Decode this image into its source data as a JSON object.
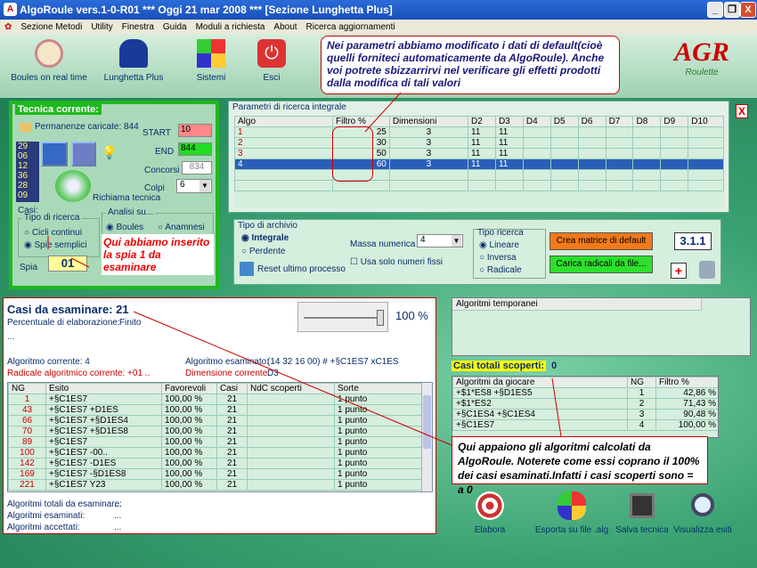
{
  "window": {
    "title": "AlgoRoule vers.1-0-R01  ***  Oggi 21 mar 2008  ***  [Sezione Lunghetta Plus]",
    "min": "_",
    "max": "❐",
    "close": "X"
  },
  "menu": [
    "Sezione Metodi",
    "Utility",
    "Finestra",
    "Guida",
    "Moduli a richiesta",
    "About",
    "Ricerca aggiornamenti"
  ],
  "toolbar": {
    "boules": "Boules on real time",
    "lunghetta": "Lunghetta Plus",
    "sistemi": "Sistemi",
    "esci": "Esci"
  },
  "logo": {
    "text": "AGR",
    "sub": "Roulette"
  },
  "callout_top": "Nei parametri abbiamo modificato i dati di default(cioè quelli forniteci automaticamente da AlgoRoule). Anche voi potrete sbizzarrirvi nel verificare gli effetti prodotti dalla modifica di tali valori",
  "tecnica": {
    "title": "Tecnica corrente:",
    "permanenze": "Permanenze caricate: 844",
    "list": [
      "29",
      "06",
      "12",
      "36",
      "28",
      "09"
    ],
    "start_label": "START",
    "start_value": "10",
    "end_label": "END",
    "end_value": "844",
    "concorsi_label": "Concorsi",
    "concorsi_value": "834",
    "colpi_label": "Colpi",
    "colpi_value": "6",
    "richiama": "Richiama tecnica",
    "casi": "Casi:",
    "tipo_ricerca": "Tipo di ricerca",
    "cicli": "Cicli continui",
    "spie": "Spie semplici",
    "spia_label": "Spia",
    "spia_value": "01",
    "analisi": "Analisi su...",
    "boules": "Boules",
    "anamnesi": "Anamnesi"
  },
  "callout_spia": "Qui abbiamo inserito la spia 1 da esaminare",
  "parametri": {
    "title": "Parametri di ricerca integrale",
    "headers": [
      "Algo",
      "Filtro %",
      "Dimensioni",
      "D2",
      "D3",
      "D4",
      "D5",
      "D6",
      "D7",
      "D8",
      "D9",
      "D10"
    ],
    "rows": [
      [
        "1",
        "25",
        "3",
        "11",
        "11"
      ],
      [
        "2",
        "30",
        "3",
        "11",
        "11"
      ],
      [
        "3",
        "50",
        "3",
        "11",
        "11"
      ],
      [
        "4",
        "60",
        "3",
        "11",
        "11"
      ]
    ]
  },
  "archivio": {
    "title": "Tipo di archivio",
    "integrale": "Integrale",
    "perdente": "Perdente",
    "massa_label": "Massa numerica",
    "massa_value": "4",
    "usa_solo": "Usa solo numeri fissi",
    "reset": "Reset ultimo processo",
    "tipo_title": "Tipo ricerca",
    "lineare": "Lineare",
    "inversa": "Inversa",
    "radicale": "Radicale",
    "crea": "Crea matrice di default",
    "carica": "Carica radicali da file...",
    "version": "3.1.1"
  },
  "casi": {
    "title": "Casi da esaminare: 21",
    "perc_label": "Percentuale di elaborazione:",
    "perc_value": "Finito",
    "dots": "...",
    "progress_text": "100 %",
    "algo_corr": "Algoritmo corrente: 4",
    "algo_esam_label": "Algoritmo esaminato:",
    "algo_esam_value": "(14 32 16 00) # +§C1ES7 xC1ES",
    "radicale": "Radicale algoritmico corrente:   +01 ..",
    "dimensione": "Dimensione corrente:",
    "dimensione_value": "D3",
    "headers": [
      "NG",
      "Esito",
      "Favorevoli",
      "Casi",
      "NdC scoperti",
      "Sorte"
    ],
    "rows": [
      [
        "1",
        "+§C1ES7",
        "100,00 %",
        "21",
        "",
        "1 punto"
      ],
      [
        "43",
        "+§C1ES7 +D1ES",
        "100,00 %",
        "21",
        "",
        "1 punto"
      ],
      [
        "66",
        "+§C1ES7 +§D1ES4",
        "100,00 %",
        "21",
        "",
        "1 punto"
      ],
      [
        "70",
        "+§C1ES7 +§D1ES8",
        "100,00 %",
        "21",
        "",
        "1 punto"
      ],
      [
        "89",
        "+§C1ES7",
        "100,00 %",
        "21",
        "",
        "1 punto"
      ],
      [
        "100",
        "+§C1ES7 -00..",
        "100,00 %",
        "21",
        "",
        "1 punto"
      ],
      [
        "142",
        "+§C1ES7 -D1ES",
        "100,00 %",
        "21",
        "",
        "1 punto"
      ],
      [
        "169",
        "+§C1ES7 -§D1ES8",
        "100,00 %",
        "21",
        "",
        "1 punto"
      ],
      [
        "221",
        "+§C1ES7 Y23",
        "100,00 %",
        "21",
        "",
        "1 punto"
      ]
    ],
    "tot_label": "Algoritmi totali da esaminare:",
    "esam_label": "Algoritmi esaminati:",
    "acc_label": "Algoritmi accettati:",
    "tot_val": "...",
    "esam_val": "...",
    "acc_val": "..."
  },
  "temporanei": {
    "title": "Algoritmi temporanei"
  },
  "scoperti": {
    "label": "Casi totali scoperti:",
    "value": "0"
  },
  "giocare": {
    "headers": [
      "Algoritmi da giocare",
      "NG",
      "Filtro %"
    ],
    "rows": [
      [
        "+$1*ES8 +§D1ES5",
        "1",
        "42,86 %"
      ],
      [
        "+$1*ES2",
        "2",
        "71,43 %"
      ],
      [
        "+§C1ES4 +§C1ES4",
        "3",
        "90,48 %"
      ],
      [
        "+§C1ES7",
        "4",
        "100,00 %"
      ]
    ]
  },
  "callout_bottom": "Qui appaiono gli algoritmi calcolati da AlgoRoule. Noterete come essi coprano il 100% dei casi esaminati.Infatti i casi scoperti sono = a 0",
  "actions": {
    "elabora": "Elabora",
    "esporta": "Esporta su file .alg",
    "salva": "Salva tecnica",
    "visualizza": "Visualizza esiti"
  },
  "close_x": "X",
  "colors": {
    "accent": "#1b4fb8",
    "panel": "#cfe8d8",
    "highlight": "#2a5fb8"
  }
}
